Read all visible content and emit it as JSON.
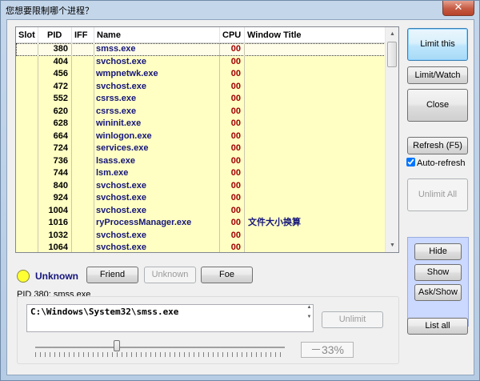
{
  "window": {
    "title": "您想要限制哪个进程？",
    "close_glyph": "✕",
    "close_icon": "close-icon"
  },
  "process_list": {
    "columns": [
      "Slot",
      "PID",
      "IFF",
      "Name",
      "CPU",
      "Window Title"
    ],
    "rows": [
      {
        "slot": "",
        "pid": "380",
        "iff": "",
        "name": "smss.exe",
        "cpu": "00",
        "window_title": ""
      },
      {
        "slot": "",
        "pid": "404",
        "iff": "",
        "name": "svchost.exe",
        "cpu": "00",
        "window_title": ""
      },
      {
        "slot": "",
        "pid": "456",
        "iff": "",
        "name": "wmpnetwk.exe",
        "cpu": "00",
        "window_title": ""
      },
      {
        "slot": "",
        "pid": "472",
        "iff": "",
        "name": "svchost.exe",
        "cpu": "00",
        "window_title": ""
      },
      {
        "slot": "",
        "pid": "552",
        "iff": "",
        "name": "csrss.exe",
        "cpu": "00",
        "window_title": ""
      },
      {
        "slot": "",
        "pid": "620",
        "iff": "",
        "name": "csrss.exe",
        "cpu": "00",
        "window_title": ""
      },
      {
        "slot": "",
        "pid": "628",
        "iff": "",
        "name": "wininit.exe",
        "cpu": "00",
        "window_title": ""
      },
      {
        "slot": "",
        "pid": "664",
        "iff": "",
        "name": "winlogon.exe",
        "cpu": "00",
        "window_title": ""
      },
      {
        "slot": "",
        "pid": "724",
        "iff": "",
        "name": "services.exe",
        "cpu": "00",
        "window_title": ""
      },
      {
        "slot": "",
        "pid": "736",
        "iff": "",
        "name": "lsass.exe",
        "cpu": "00",
        "window_title": ""
      },
      {
        "slot": "",
        "pid": "744",
        "iff": "",
        "name": "lsm.exe",
        "cpu": "00",
        "window_title": ""
      },
      {
        "slot": "",
        "pid": "840",
        "iff": "",
        "name": "svchost.exe",
        "cpu": "00",
        "window_title": ""
      },
      {
        "slot": "",
        "pid": "924",
        "iff": "",
        "name": "svchost.exe",
        "cpu": "00",
        "window_title": ""
      },
      {
        "slot": "",
        "pid": "1004",
        "iff": "",
        "name": "svchost.exe",
        "cpu": "00",
        "window_title": ""
      },
      {
        "slot": "",
        "pid": "1016",
        "iff": "",
        "name": "ryProcessManager.exe",
        "cpu": "00",
        "window_title": "文件大小换算"
      },
      {
        "slot": "",
        "pid": "1032",
        "iff": "",
        "name": "svchost.exe",
        "cpu": "00",
        "window_title": ""
      },
      {
        "slot": "",
        "pid": "1064",
        "iff": "",
        "name": "svchost.exe",
        "cpu": "00",
        "window_title": ""
      }
    ],
    "selected_index": 0
  },
  "iff": {
    "status_label": "Unknown",
    "status_color": "#ffff33",
    "friend_label": "Friend",
    "unknown_label": "Unknown",
    "foe_label": "Foe"
  },
  "target": {
    "pid_line": "PID 380: smss.exe",
    "path": "C:\\Windows\\System32\\smss.exe",
    "unlimit_label": "Unlimit",
    "limit_percent_text": "－33%",
    "limit_percent_value": -33
  },
  "sidebar": {
    "limit_this_label": "Limit this",
    "limit_watch_label": "Limit/Watch",
    "close_label": "Close",
    "refresh_label": "Refresh (F5)",
    "auto_refresh_label": "Auto-refresh",
    "auto_refresh_checked": true,
    "unlimit_all_label": "Unlimit All",
    "hide_label": "Hide",
    "show_label": "Show",
    "ask_show_label": "Ask/Show",
    "list_all_label": "List all"
  },
  "colors": {
    "row_background": "#ffffc4",
    "name_text": "#15157a",
    "cpu_text": "#a00000",
    "panel_background": "#cbd8ff"
  }
}
